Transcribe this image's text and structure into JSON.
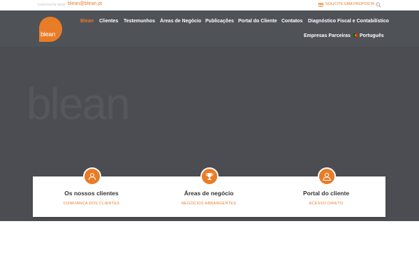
{
  "topbar": {
    "contact_label": "CONTACTE-NOS:",
    "contact_email": "blean@blean.pt",
    "proposal_label": "SOLICITE UMA PROPOSTA →"
  },
  "brand": {
    "logo_text": "blean",
    "hero_wordmark": "blean"
  },
  "nav": {
    "items": [
      {
        "label": "Blean",
        "active": true
      },
      {
        "label": "Clientes"
      },
      {
        "label": "Testemunhos"
      },
      {
        "label": "Áreas de Negócio"
      },
      {
        "label": "Publicações"
      },
      {
        "label": "Portal do Cliente"
      },
      {
        "label": "Contatos"
      },
      {
        "label": "Diagnóstico Fiscal e Contabilístico"
      },
      {
        "label": "Empresas Parceiras"
      },
      {
        "label": "Português"
      }
    ]
  },
  "cards": [
    {
      "title": "Os nossos clientes",
      "subtitle": "CONFIANÇA DOS CLIENTES",
      "icon": "person-icon"
    },
    {
      "title": "Áreas de negócio",
      "subtitle": "NEGÓCIOS ABRANGENTES",
      "icon": "trophy-icon"
    },
    {
      "title": "Portal do cliente",
      "subtitle": "ACESSO DIRETO",
      "icon": "user-icon"
    }
  ],
  "colors": {
    "accent": "#e97c27",
    "header_bg": "#4f5257",
    "hero_bg": "#4b4d52"
  }
}
